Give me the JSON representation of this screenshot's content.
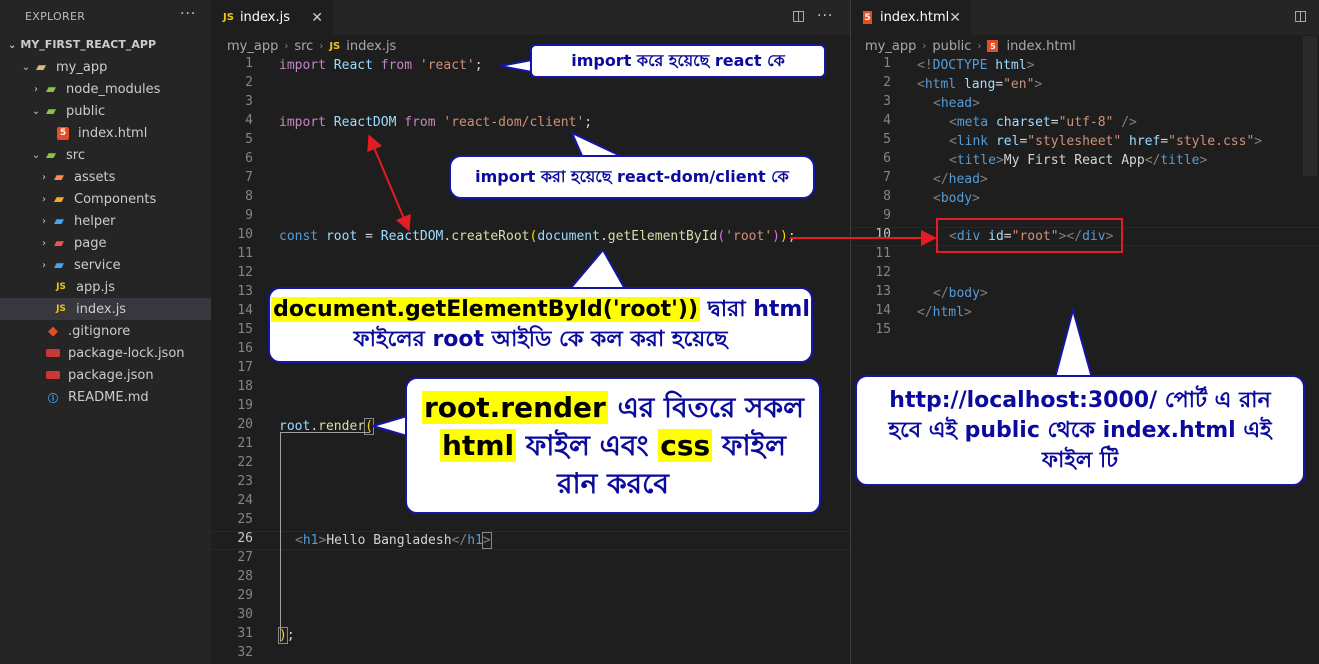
{
  "sidebar": {
    "title": "EXPLORER",
    "more": "···",
    "project": "MY_FIRST_REACT_APP",
    "items": [
      {
        "label": "my_app"
      },
      {
        "label": "node_modules"
      },
      {
        "label": "public"
      },
      {
        "label": "index.html"
      },
      {
        "label": "src"
      },
      {
        "label": "assets"
      },
      {
        "label": "Components"
      },
      {
        "label": "helper"
      },
      {
        "label": "page"
      },
      {
        "label": "service"
      },
      {
        "label": "app.js"
      },
      {
        "label": "index.js"
      },
      {
        "label": ".gitignore"
      },
      {
        "label": "package-lock.json"
      },
      {
        "label": "package.json"
      },
      {
        "label": "README.md"
      }
    ]
  },
  "editor1": {
    "tab_label": "index.js",
    "tab_icon": "JS",
    "breadcrumb": [
      "my_app",
      "src",
      "index.js"
    ],
    "current_line": "26",
    "line_numbers": [
      "1",
      "2",
      "3",
      "4",
      "5",
      "6",
      "7",
      "8",
      "9",
      "10",
      "11",
      "12",
      "13",
      "14",
      "15",
      "16",
      "17",
      "18",
      "19",
      "20",
      "21",
      "22",
      "23",
      "24",
      "25",
      "26",
      "27",
      "28",
      "29",
      "30",
      "31",
      "32"
    ]
  },
  "editor2": {
    "tab_label": "index.html",
    "tab_icon": "5",
    "breadcrumb": [
      "my_app",
      "public",
      "index.html"
    ],
    "current_line": "10",
    "line_numbers": [
      "1",
      "2",
      "3",
      "4",
      "5",
      "6",
      "7",
      "8",
      "9",
      "10",
      "11",
      "12",
      "13",
      "14",
      "15"
    ]
  },
  "callouts": {
    "c1": "import করে হয়েছে react কে",
    "c2": "import করা হয়েছে react-dom/client কে",
    "c3_hl": "document.getElementById('root'))",
    "c3_rest": " দ্বারা html",
    "c3_line2": "ফাইলের root আইডি কে কল করা হয়েছে",
    "c4_hl1": "root.render",
    "c4_rest1": " এর বিতরে সকল",
    "c4_a": "html",
    "c4_b": " ফাইল এবং ",
    "c4_c": "css",
    "c4_d": " ফাইল",
    "c4_line3": "রান করবে",
    "c5_line1": "http://localhost:3000/ পোর্ট এ রান",
    "c5_line2": "হবে এই public থেকে index.html এই",
    "c5_line3": "ফাইল টি"
  },
  "colors": {
    "callout_border": "#1515a8",
    "callout_text": "#0a0a9e",
    "highlight": "#ffff00",
    "arrow": "#e51c23"
  }
}
